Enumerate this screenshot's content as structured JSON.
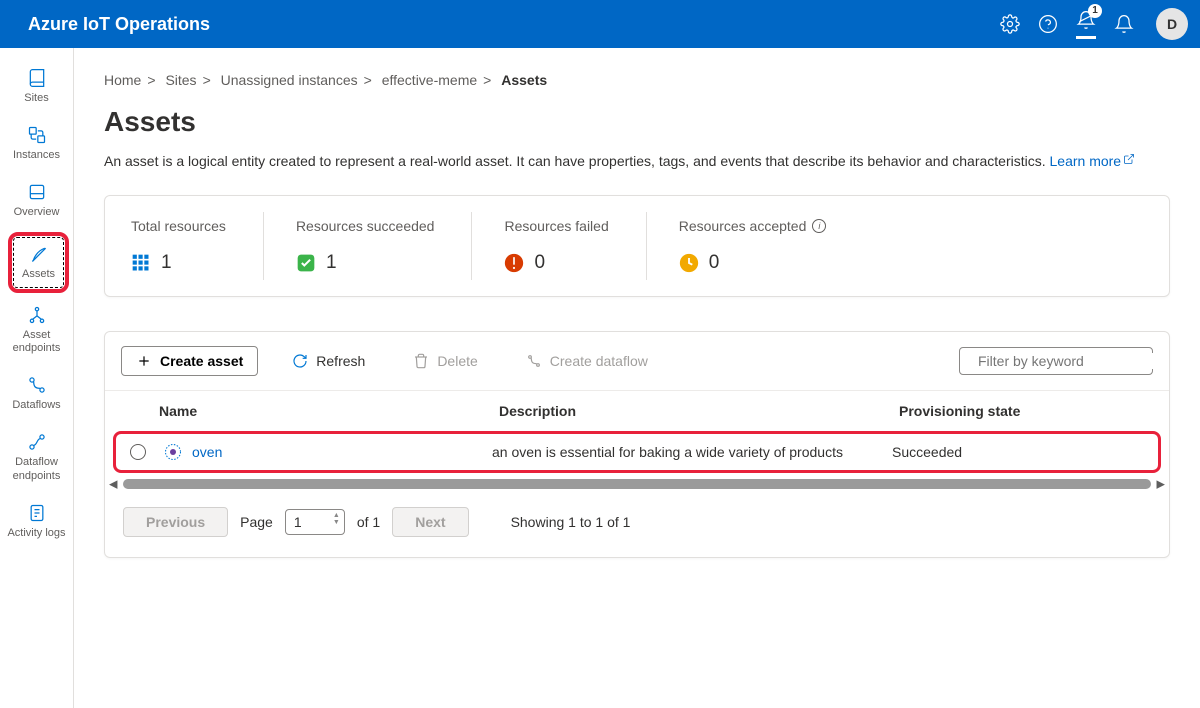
{
  "header": {
    "title": "Azure IoT Operations",
    "notif_count": "1",
    "avatar_letter": "D"
  },
  "sidebar": [
    {
      "label": "Sites"
    },
    {
      "label": "Instances"
    },
    {
      "label": "Overview"
    },
    {
      "label": "Assets"
    },
    {
      "label": "Asset endpoints"
    },
    {
      "label": "Dataflows"
    },
    {
      "label": "Dataflow endpoints"
    },
    {
      "label": "Activity logs"
    }
  ],
  "breadcrumb": {
    "i0": "Home",
    "i1": "Sites",
    "i2": "Unassigned instances",
    "i3": "effective-meme",
    "i4": "Assets"
  },
  "page_title": "Assets",
  "page_desc": "An asset is a logical entity created to represent a real-world asset. It can have properties, tags, and events that describe its behavior and characteristics.",
  "learn_more": "Learn more",
  "stats": {
    "total_label": "Total resources",
    "total_value": "1",
    "succeeded_label": "Resources succeeded",
    "succeeded_value": "1",
    "failed_label": "Resources failed",
    "failed_value": "0",
    "accepted_label": "Resources accepted",
    "accepted_value": "0"
  },
  "toolbar": {
    "create": "Create asset",
    "refresh": "Refresh",
    "delete": "Delete",
    "dataflow": "Create dataflow",
    "filter_placeholder": "Filter by keyword"
  },
  "columns": {
    "name": "Name",
    "desc": "Description",
    "state": "Provisioning state"
  },
  "row": {
    "name": "oven",
    "desc": "an oven is essential for baking a wide variety of products",
    "state": "Succeeded"
  },
  "pager": {
    "prev": "Previous",
    "next": "Next",
    "page_label": "Page",
    "page_value": "1",
    "of_label": "of 1",
    "showing": "Showing 1 to 1 of 1"
  }
}
